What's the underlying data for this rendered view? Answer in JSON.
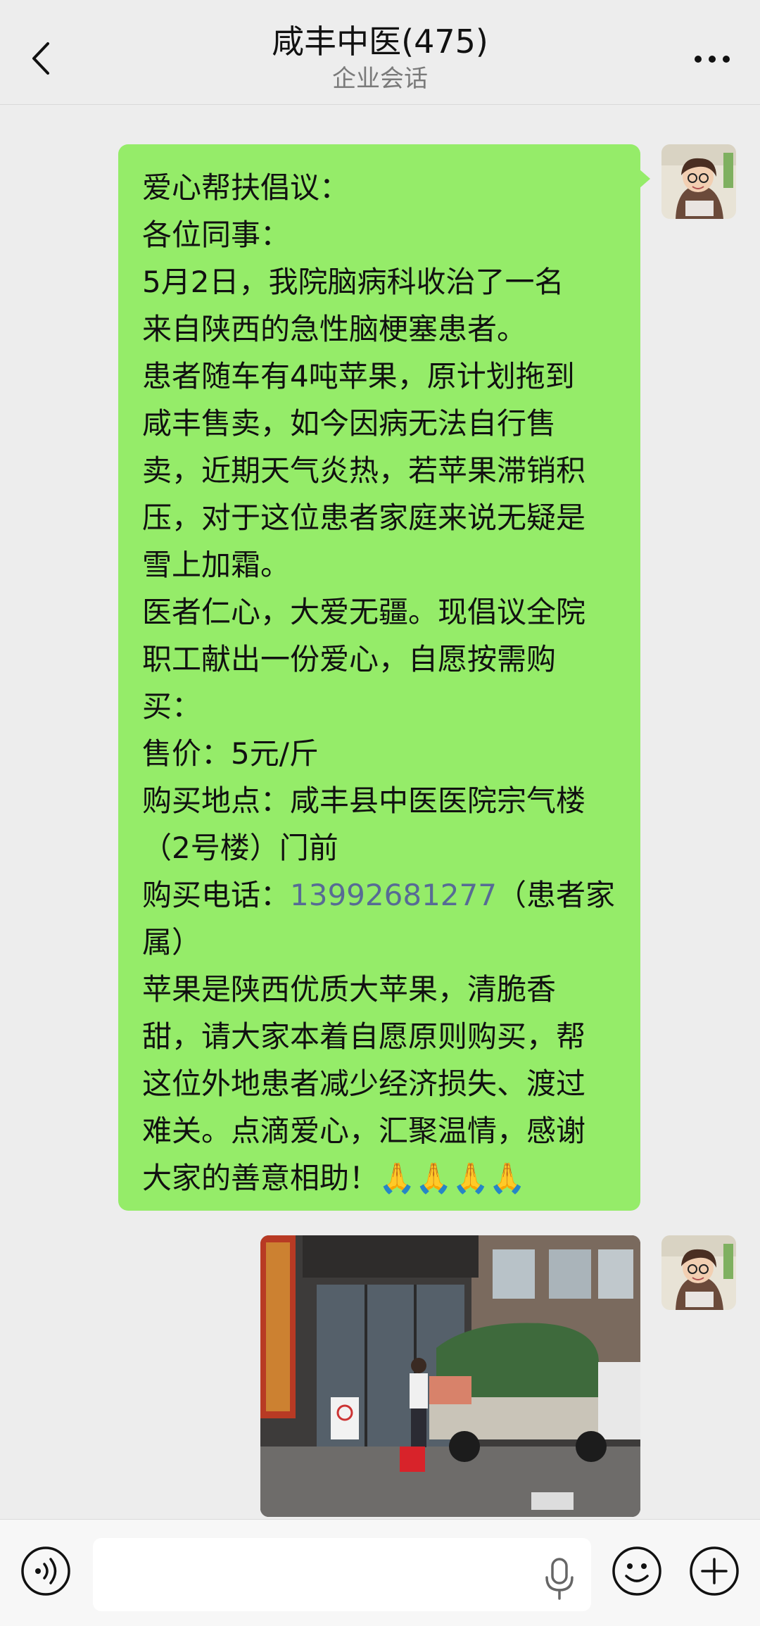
{
  "header": {
    "title": "咸丰中医(475)",
    "subtitle": "企业会话",
    "back_icon": "chevron-left-icon",
    "more_icon": "more-dots-icon"
  },
  "message": {
    "bubble_color": "#95ec69",
    "lines": [
      "爱心帮扶倡议：",
      "各位同事：",
      "5月2日，我院脑病科收治了一名",
      "来自陕西的急性脑梗塞患者。",
      "患者随车有4吨苹果，原计划拖到",
      "咸丰售卖，如今因病无法自行售",
      "卖，近期天气炎热，若苹果滞销积",
      "压，对于这位患者家庭来说无疑是",
      "雪上加霜。",
      "医者仁心，大爱无疆。现倡议全院",
      "职工献出一份爱心，自愿按需购",
      "买：",
      "售价：5元/斤",
      "购买地点：咸丰县中医医院宗气楼",
      "（2号楼）门前",
      "购买电话：",
      "（患者家",
      "属）",
      "苹果是陕西优质大苹果，清脆香",
      "甜，请大家本着自愿原则购买，帮",
      "这位外地患者减少经济损失、渡过",
      "难关。点滴爱心，汇聚温情，感谢",
      "大家的善意相助！🙏🙏🙏🙏"
    ],
    "phone": "13992681277",
    "phone_color": "#576b95"
  },
  "input_bar": {
    "voice_icon": "voice-icon",
    "mic_icon": "microphone-icon",
    "emoji_icon": "emoji-icon",
    "plus_icon": "plus-icon"
  }
}
